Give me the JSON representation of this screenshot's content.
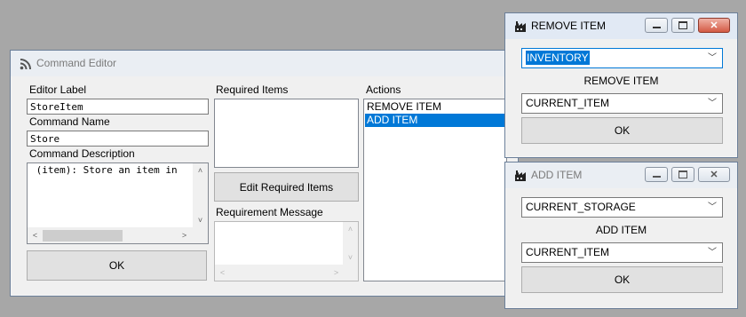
{
  "command_editor": {
    "title": "Command Editor",
    "editor_label_caption": "Editor Label",
    "editor_label_value": "StoreItem",
    "command_name_caption": "Command Name",
    "command_name_value": "Store",
    "command_description_caption": "Command Description",
    "command_description_value": " (item): Store an item in",
    "ok_label": "OK",
    "required_items_caption": "Required Items",
    "edit_required_items_label": "Edit Required Items",
    "requirement_message_caption": "Requirement Message",
    "actions_caption": "Actions",
    "actions": [
      "REMOVE ITEM",
      "ADD ITEM"
    ],
    "selected_action": "ADD ITEM"
  },
  "remove_item_dialog": {
    "title": "REMOVE ITEM",
    "source_value": "INVENTORY",
    "center_label": "REMOVE ITEM",
    "target_value": "CURRENT_ITEM",
    "ok_label": "OK"
  },
  "add_item_dialog": {
    "title": "ADD ITEM",
    "source_value": "CURRENT_STORAGE",
    "center_label": "ADD ITEM",
    "target_value": "CURRENT_ITEM",
    "ok_label": "OK"
  },
  "icons": {
    "command_editor_icon": "rss-icon",
    "dialog_icon": "factory-icon",
    "minimize": "minimize-icon",
    "maximize": "maximize-icon",
    "close": "close-icon",
    "dropdown": "chevron-down-icon"
  },
  "colors": {
    "desktop": "#a7a7a7",
    "selection": "#0078d7",
    "close_active": "#d35a44"
  }
}
